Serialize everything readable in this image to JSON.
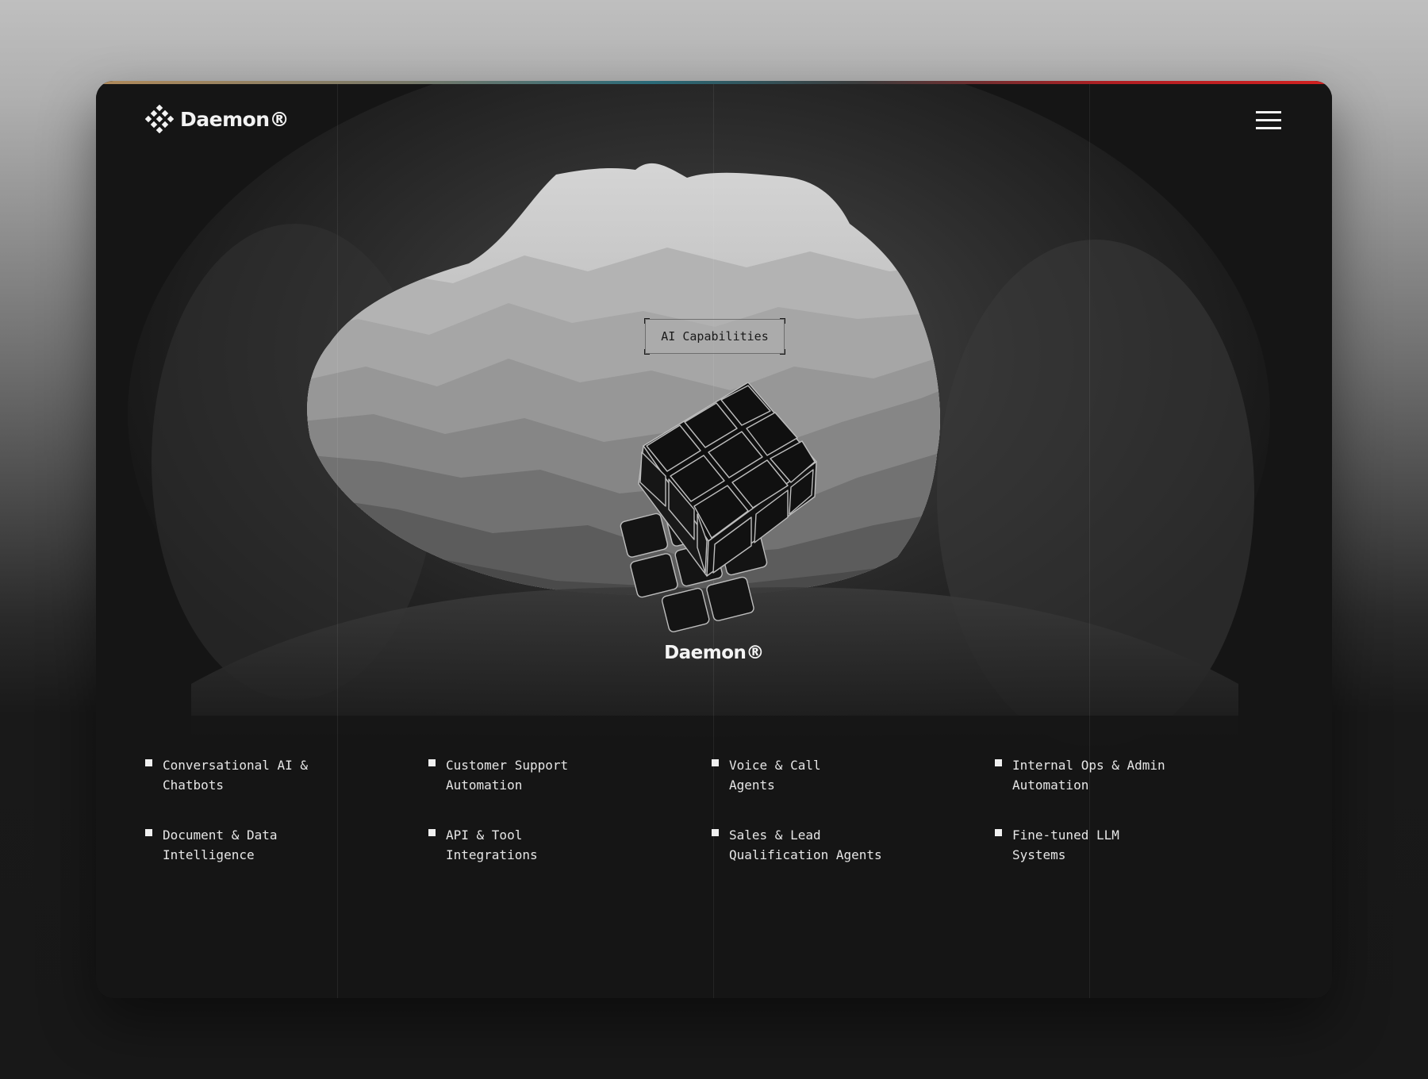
{
  "brand": {
    "name": "Daemon®"
  },
  "header": {
    "menu_icon": "hamburger-icon"
  },
  "hero": {
    "badge_label": "AI Capabilities",
    "wordmark": "Daemon®"
  },
  "capabilities": [
    "Conversational AI & Chatbots",
    "Customer Support Automation",
    "Voice & Call Agents",
    "Internal Ops & Admin Automation",
    "Document & Data Intelligence",
    "API & Tool Integrations",
    "Sales & Lead Qualification Agents",
    "Fine-tuned LLM Systems"
  ],
  "colors": {
    "background": "#151515",
    "text": "#e6e6e6",
    "accent_red": "#d22020"
  }
}
